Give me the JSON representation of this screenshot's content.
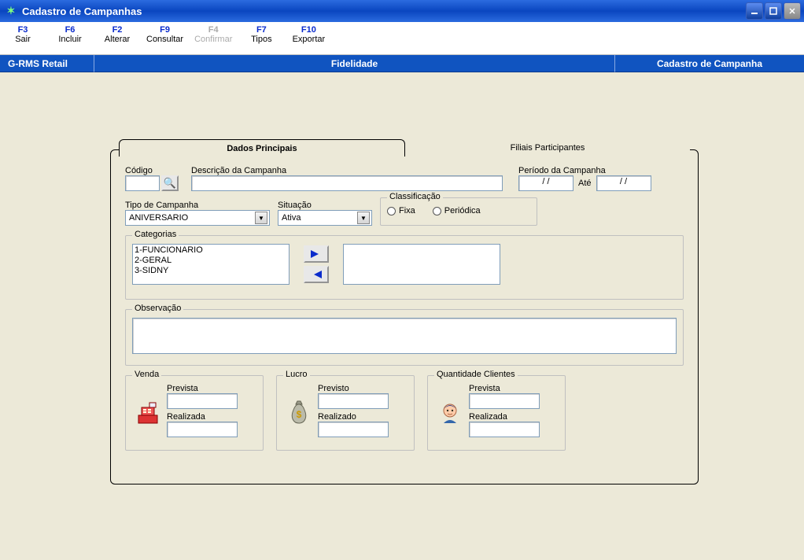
{
  "window": {
    "title": "Cadastro de Campanhas"
  },
  "toolbar": [
    {
      "key": "F3",
      "label": "Sair",
      "disabled": false
    },
    {
      "key": "F6",
      "label": "Incluir",
      "disabled": false
    },
    {
      "key": "F2",
      "label": "Alterar",
      "disabled": false
    },
    {
      "key": "F9",
      "label": "Consultar",
      "disabled": false
    },
    {
      "key": "F4",
      "label": "Confirmar",
      "disabled": true
    },
    {
      "key": "F7",
      "label": "Tipos",
      "disabled": false
    },
    {
      "key": "F10",
      "label": "Exportar",
      "disabled": false
    }
  ],
  "statusband": {
    "left": "G-RMS Retail",
    "mid": "Fidelidade",
    "right": "Cadastro de Campanha"
  },
  "tabs": {
    "active": "Dados Principais",
    "inactive": "Filiais Participantes"
  },
  "fields": {
    "codigo_label": "Código",
    "codigo_value": "",
    "descricao_label": "Descrição da Campanha",
    "descricao_value": "",
    "periodo_label": "Período da Campanha",
    "periodo_from": "  /  /",
    "periodo_sep": "Até",
    "periodo_to": "  /  /",
    "tipo_label": "Tipo de Campanha",
    "tipo_value": "ANIVERSARIO",
    "situacao_label": "Situação",
    "situacao_value": "Ativa",
    "classificacao_label": "Classificação",
    "classificacao_options": {
      "fixa": "Fixa",
      "periodica": "Periódica"
    }
  },
  "categorias": {
    "legend": "Categorias",
    "available": [
      "1-FUNCIONARIO",
      "2-GERAL",
      "3-SIDNY"
    ],
    "selected": []
  },
  "observacao": {
    "legend": "Observação",
    "value": ""
  },
  "venda": {
    "legend": "Venda",
    "prevista_label": "Prevista",
    "prevista_value": "",
    "realizada_label": "Realizada",
    "realizada_value": ""
  },
  "lucro": {
    "legend": "Lucro",
    "previsto_label": "Previsto",
    "previsto_value": "",
    "realizado_label": "Realizado",
    "realizado_value": ""
  },
  "clientes": {
    "legend": "Quantidade Clientes",
    "prevista_label": "Prevista",
    "prevista_value": "",
    "realizada_label": "Realizada",
    "realizada_value": ""
  }
}
